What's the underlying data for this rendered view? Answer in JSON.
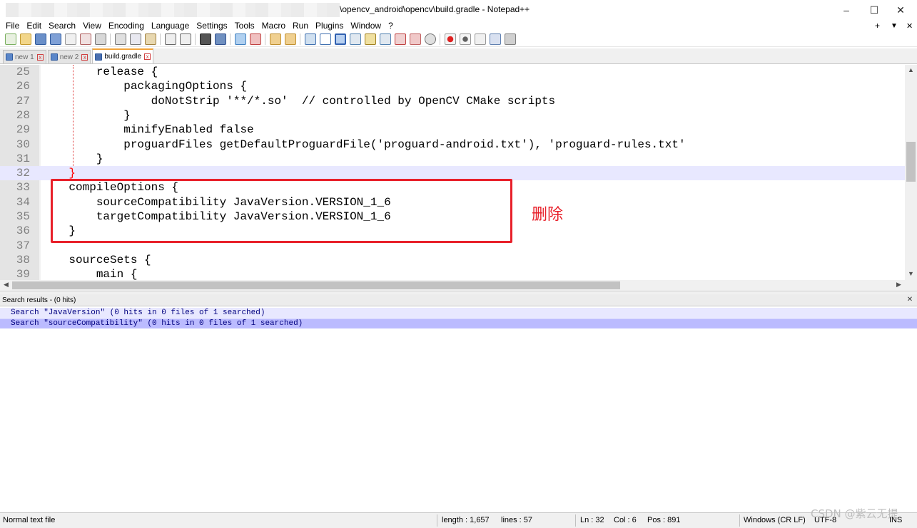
{
  "window": {
    "title": "\\opencv_android\\opencv\\build.gradle - Notepad++",
    "minimize": "–",
    "maximize": "☐",
    "close": "✕"
  },
  "menu": {
    "items": [
      "File",
      "Edit",
      "Search",
      "View",
      "Encoding",
      "Language",
      "Settings",
      "Tools",
      "Macro",
      "Run",
      "Plugins",
      "Window",
      "?"
    ],
    "right_plus": "+",
    "right_down": "▼",
    "right_close": "✕"
  },
  "tabs": [
    {
      "label": "new 1",
      "active": false
    },
    {
      "label": "new 2",
      "active": false
    },
    {
      "label": "build.gradle",
      "active": true
    }
  ],
  "editor": {
    "lines": [
      {
        "num": "25",
        "text": "        release {"
      },
      {
        "num": "26",
        "text": "            packagingOptions {"
      },
      {
        "num": "27",
        "text": "                doNotStrip '**/*.so'  // controlled by OpenCV CMake scripts"
      },
      {
        "num": "28",
        "text": "            }"
      },
      {
        "num": "29",
        "text": "            minifyEnabled false"
      },
      {
        "num": "30",
        "text": "            proguardFiles getDefaultProguardFile('proguard-android.txt'), 'proguard-rules.txt'"
      },
      {
        "num": "31",
        "text": "        }"
      },
      {
        "num": "32",
        "text": "    }"
      },
      {
        "num": "33",
        "text": "    compileOptions {"
      },
      {
        "num": "34",
        "text": "        sourceCompatibility JavaVersion.VERSION_1_6"
      },
      {
        "num": "35",
        "text": "        targetCompatibility JavaVersion.VERSION_1_6"
      },
      {
        "num": "36",
        "text": "    }"
      },
      {
        "num": "37",
        "text": ""
      },
      {
        "num": "38",
        "text": "    sourceSets {"
      },
      {
        "num": "39",
        "text": "        main {"
      }
    ],
    "current_line": "32",
    "annotation": "删除"
  },
  "search_panel": {
    "header": "Search results - (0 hits)",
    "close": "✕",
    "results": [
      "Search \"JavaVersion\" (0 hits in 0 files of 1 searched)",
      "Search \"sourceCompatibility\" (0 hits in 0 files of 1 searched)"
    ]
  },
  "status": {
    "file_type": "Normal text file",
    "length": "length : 1,657",
    "lines": "lines : 57",
    "ln": "Ln : 32",
    "col": "Col : 6",
    "pos": "Pos : 891",
    "eol": "Windows (CR LF)",
    "encoding": "UTF-8",
    "mode": "INS"
  },
  "watermark": "CSDN @紫云无提",
  "colors": {
    "highlight_box": "#e8202a",
    "current_line": "#e8e8ff",
    "selected_result": "#bbbbff",
    "active_tab_accent": "#f2a33a"
  }
}
